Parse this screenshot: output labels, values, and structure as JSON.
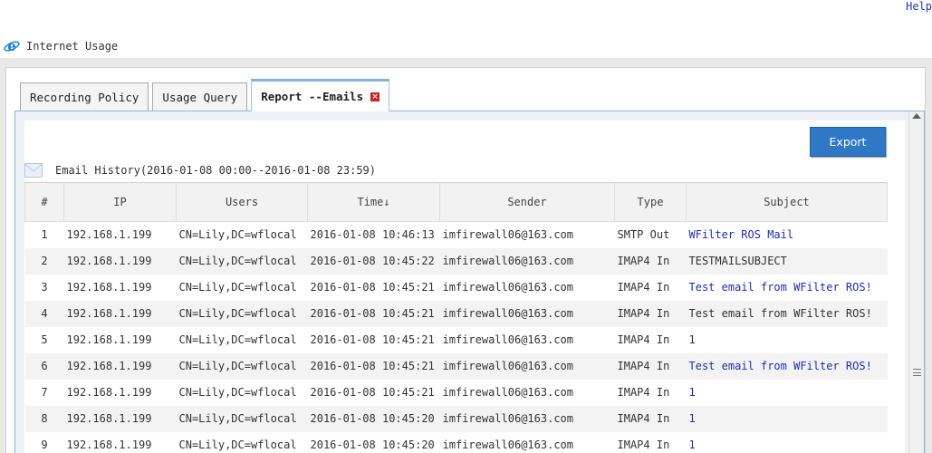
{
  "header": {
    "help_label": "Help",
    "app_title": "Internet Usage"
  },
  "tabs": [
    {
      "label": "Recording Policy",
      "active": false
    },
    {
      "label": "Usage Query",
      "active": false
    },
    {
      "label": "Report --Emails",
      "active": true,
      "closable": true
    }
  ],
  "toolbar": {
    "export_label": "Export"
  },
  "history": {
    "label": "Email History(2016-01-08 00:00--2016-01-08 23:59)"
  },
  "table": {
    "columns": [
      "#",
      "IP",
      "Users",
      "Time↓",
      "Sender",
      "Type",
      "Subject"
    ],
    "rows": [
      {
        "n": "1",
        "ip": "192.168.1.199",
        "user": "CN=Lily,DC=wflocal",
        "time": "2016-01-08 10:46:13",
        "sender": "imfirewall06@163.com",
        "type": "SMTP Out",
        "subject": "WFilter ROS Mail",
        "link": true
      },
      {
        "n": "2",
        "ip": "192.168.1.199",
        "user": "CN=Lily,DC=wflocal",
        "time": "2016-01-08 10:45:22",
        "sender": "imfirewall06@163.com",
        "type": "IMAP4 In",
        "subject": "TESTMAILSUBJECT",
        "link": false
      },
      {
        "n": "3",
        "ip": "192.168.1.199",
        "user": "CN=Lily,DC=wflocal",
        "time": "2016-01-08 10:45:21",
        "sender": "imfirewall06@163.com",
        "type": "IMAP4 In",
        "subject": "Test email from WFilter ROS!",
        "link": true
      },
      {
        "n": "4",
        "ip": "192.168.1.199",
        "user": "CN=Lily,DC=wflocal",
        "time": "2016-01-08 10:45:21",
        "sender": "imfirewall06@163.com",
        "type": "IMAP4 In",
        "subject": "Test email from WFilter ROS!",
        "link": false
      },
      {
        "n": "5",
        "ip": "192.168.1.199",
        "user": "CN=Lily,DC=wflocal",
        "time": "2016-01-08 10:45:21",
        "sender": "imfirewall06@163.com",
        "type": "IMAP4 In",
        "subject": "1",
        "link": false
      },
      {
        "n": "6",
        "ip": "192.168.1.199",
        "user": "CN=Lily,DC=wflocal",
        "time": "2016-01-08 10:45:21",
        "sender": "imfirewall06@163.com",
        "type": "IMAP4 In",
        "subject": "Test email from WFilter ROS!",
        "link": true
      },
      {
        "n": "7",
        "ip": "192.168.1.199",
        "user": "CN=Lily,DC=wflocal",
        "time": "2016-01-08 10:45:21",
        "sender": "imfirewall06@163.com",
        "type": "IMAP4 In",
        "subject": "1",
        "link": true
      },
      {
        "n": "8",
        "ip": "192.168.1.199",
        "user": "CN=Lily,DC=wflocal",
        "time": "2016-01-08 10:45:20",
        "sender": "imfirewall06@163.com",
        "type": "IMAP4 In",
        "subject": "1",
        "link": true
      },
      {
        "n": "9",
        "ip": "192.168.1.199",
        "user": "CN=Lily,DC=wflocal",
        "time": "2016-01-08 10:45:20",
        "sender": "imfirewall06@163.com",
        "type": "IMAP4 In",
        "subject": "1",
        "link": true
      }
    ]
  },
  "colors": {
    "accent": "#2f78c6",
    "link": "#1a2fb5",
    "tab_active_border": "#7fb2e3",
    "close": "#cc2222"
  },
  "icons": {
    "app": "ie-icon",
    "close": "close-icon",
    "mail": "mail-icon"
  }
}
